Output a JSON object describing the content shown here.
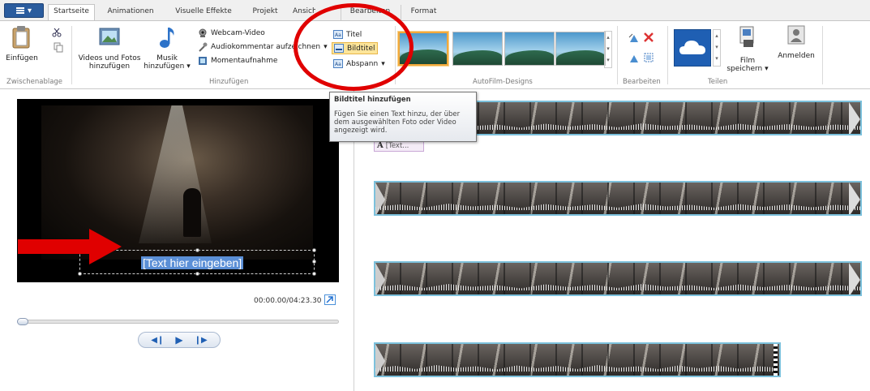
{
  "tabs": {
    "app_menu_icon": "list-icon",
    "items": [
      {
        "label": "Startseite",
        "active": true
      },
      {
        "label": "Animationen"
      },
      {
        "label": "Visuelle Effekte"
      },
      {
        "label": "Projekt"
      },
      {
        "label": "Ansicht"
      },
      {
        "label": "Bearbeiten"
      },
      {
        "label": "Format"
      }
    ]
  },
  "ribbon": {
    "clipboard": {
      "paste": "Einfügen",
      "group": "Zwischenablage"
    },
    "add": {
      "videos_photos": [
        "Videos und Fotos",
        "hinzufügen"
      ],
      "music": [
        "Musik",
        "hinzufügen"
      ],
      "webcam": "Webcam-Video",
      "narration": "Audiokommentar aufzeichnen",
      "snapshot": "Momentaufnahme",
      "title": "Titel",
      "caption": "Bildtitel",
      "credits": "Abspann",
      "group": "Hinzufügen"
    },
    "themes": {
      "group": "AutoFilm-Designs"
    },
    "edit": {
      "group": "Bearbeiten"
    },
    "share": {
      "save_movie": [
        "Film",
        "speichern"
      ],
      "sign_in": "Anmelden",
      "group": "Teilen"
    }
  },
  "tooltip": {
    "title": "Bildtitel hinzufügen",
    "body": "Fügen Sie einen Text hinzu, der über dem ausgewählten Foto oder Video angezeigt wird."
  },
  "preview": {
    "caption_text": "[Text hier eingeben]",
    "timecode": "00:00.00/04:23.30"
  },
  "storyboard": {
    "caption_chip": "[Text..."
  },
  "colors": {
    "annotation_red": "#e00000",
    "clip_border": "#7cc1dc",
    "accent_blue": "#2a5c9e",
    "selection": "#5b8fd6"
  }
}
